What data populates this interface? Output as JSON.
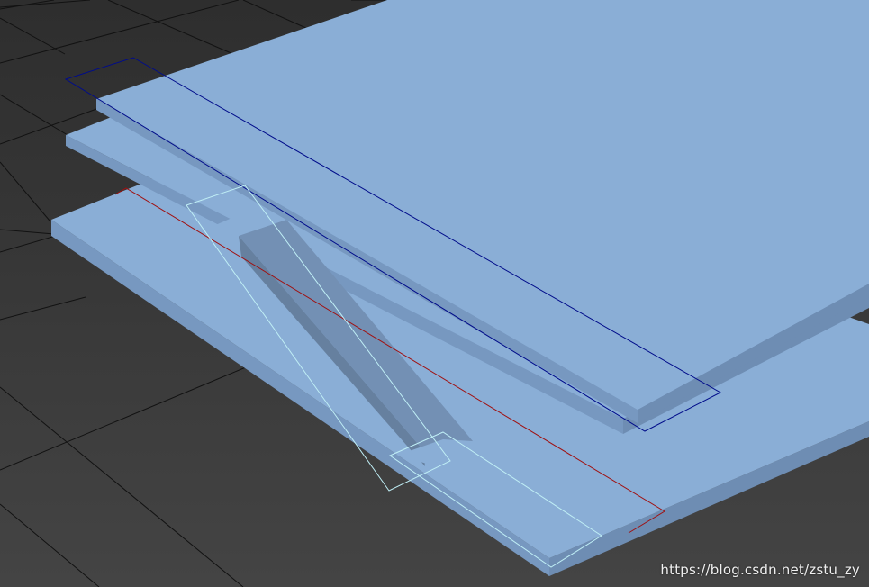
{
  "viewport": {
    "watermark": "https://blog.csdn.net/zstu_zy"
  },
  "colors": {
    "background": "#3d3d3d",
    "grid_line": "#111111",
    "slab_top": "#8aaed6",
    "slab_side": "#7798c0",
    "slab_edge": "#6e8db3",
    "beam_face": "#7390b4",
    "beam_side": "#66809f",
    "selection_blue": "#000c8a",
    "selection_red": "#a01010",
    "selection_cyan": "#bfeef5"
  }
}
